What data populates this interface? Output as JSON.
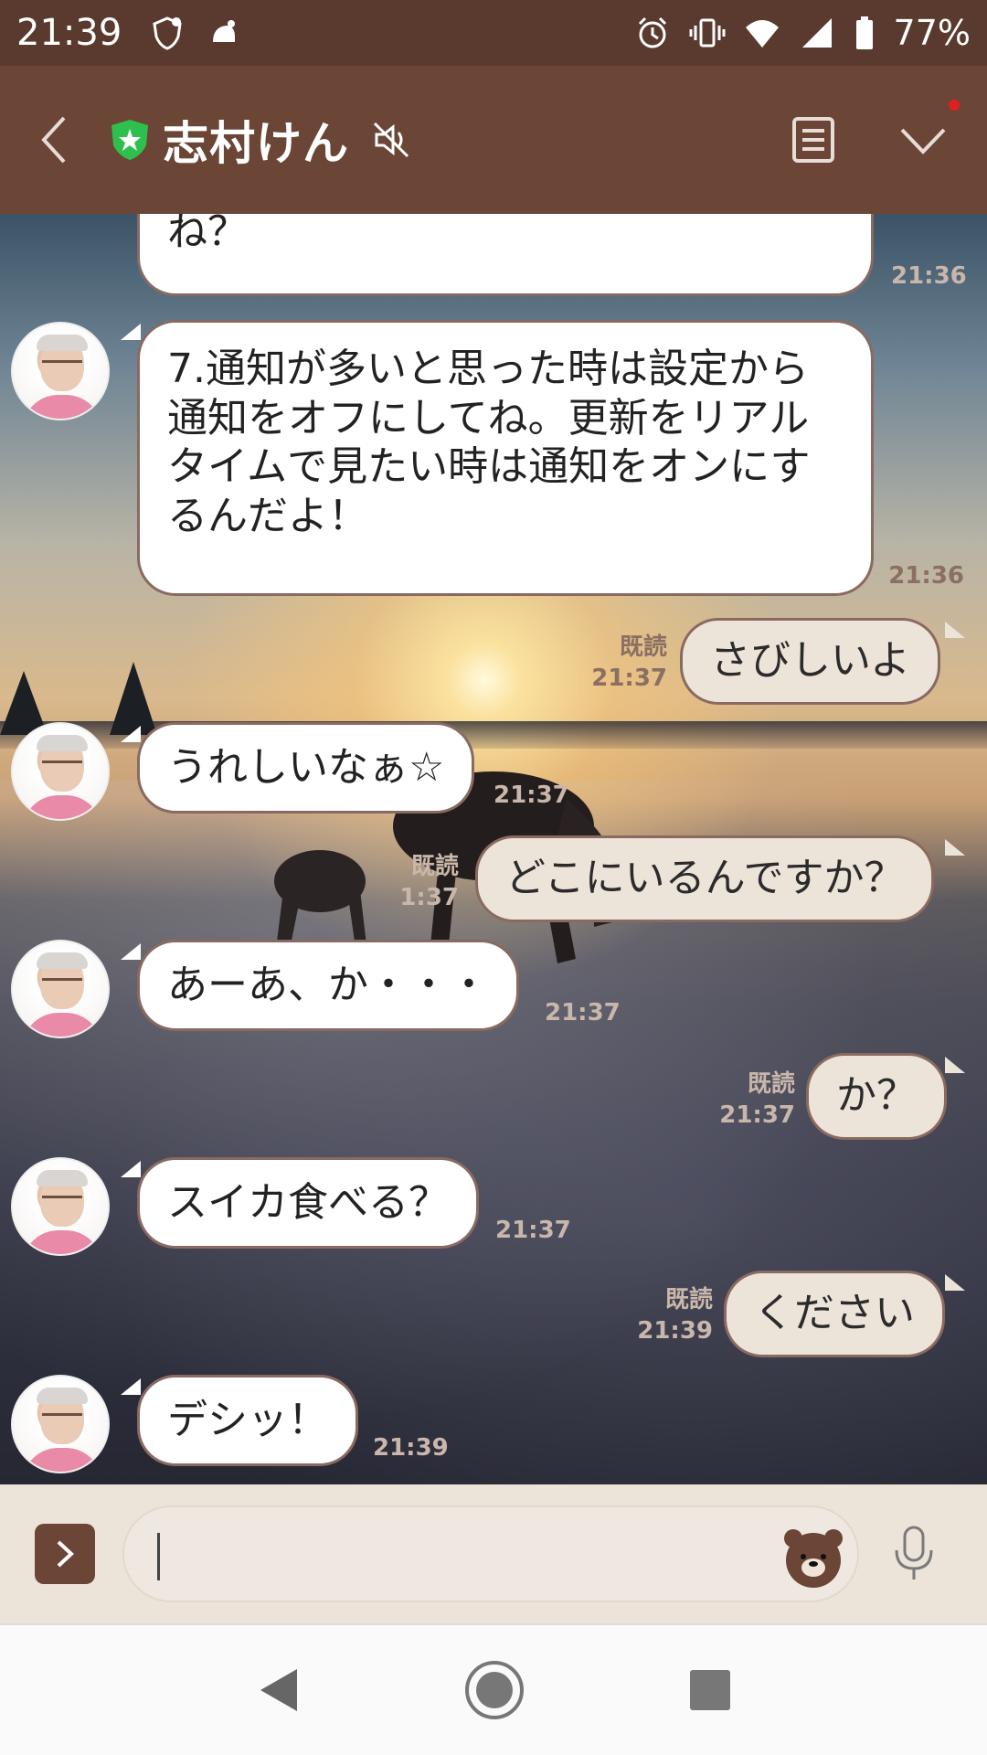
{
  "status_bar": {
    "time": "21:39",
    "battery": "77%"
  },
  "header": {
    "title": "志村けん"
  },
  "messages": [
    {
      "side": "in",
      "text": "ね？",
      "time": "21:36"
    },
    {
      "side": "in",
      "text": "7.通知が多いと思った時は設定から通知をオフにしてね。更新をリアルタイムで見たい時は通知をオンにするんだよ！",
      "time": "21:36"
    },
    {
      "side": "out",
      "text": "さびしいよ",
      "read": "既読",
      "time": "21:37"
    },
    {
      "side": "in",
      "text": "うれしいなぁ☆",
      "time": "21:37"
    },
    {
      "side": "out",
      "text": "どこにいるんですか？",
      "read": "既読",
      "time": "1:37"
    },
    {
      "side": "in",
      "text": "あーあ、か・・・",
      "time": "21:37"
    },
    {
      "side": "out",
      "text": "か？",
      "read": "既読",
      "time": "21:37"
    },
    {
      "side": "in",
      "text": "スイカ食べる？",
      "time": "21:37"
    },
    {
      "side": "out",
      "text": "ください",
      "read": "既読",
      "time": "21:39"
    },
    {
      "side": "in",
      "text": "デシッ！",
      "time": "21:39"
    }
  ],
  "icons": {
    "back": "chevron-left-icon",
    "shield": "shield-star-icon",
    "mute": "mute-icon",
    "menu": "menu-list-icon",
    "expand": "chevron-down-icon",
    "sticker": "bear-sticker-icon",
    "mic": "microphone-icon"
  },
  "colors": {
    "header": "#6b4536",
    "status_bar": "#5a3a2e",
    "bubble_in": "#ffffff",
    "bubble_out": "#ece3d9",
    "time_text": "#8a6f63",
    "shield_green": "#2fbf4f"
  }
}
